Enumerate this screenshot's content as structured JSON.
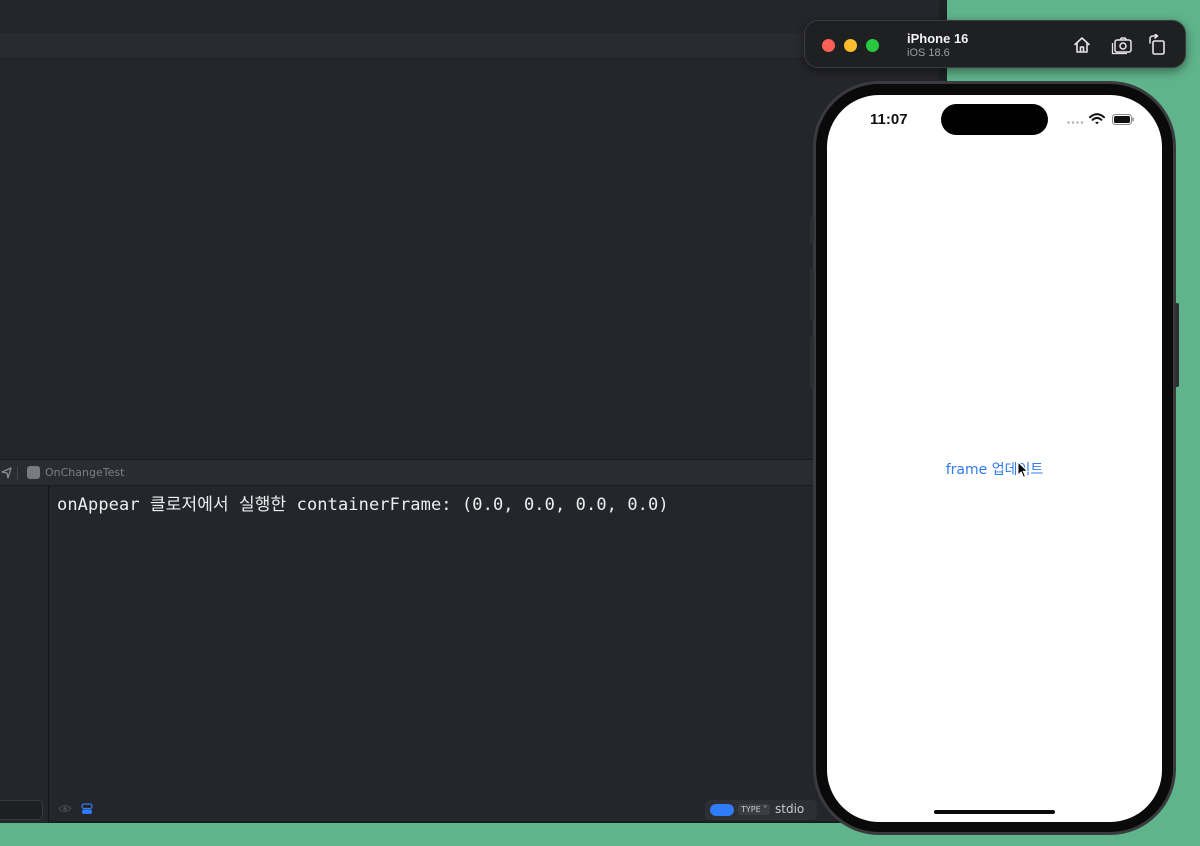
{
  "xcode": {
    "scheme_name": "OnChangeTest",
    "console_output": "onAppear 클로저에서 실행한 containerFrame: (0.0, 0.0, 0.0, 0.0)",
    "type_label": "TYPE",
    "stream_label": "stdio"
  },
  "simulator": {
    "device_name": "iPhone 16",
    "os_version": "iOS 18.6",
    "buttons": [
      "home-icon",
      "screenshot-icon",
      "rotate-icon"
    ]
  },
  "phone": {
    "time": "11:07",
    "button_label": "frame 업데이트"
  },
  "colors": {
    "background": "#5fb48b",
    "xcode_bg": "#25262b",
    "accent_blue": "#2f7cf6",
    "link_blue": "#2f7ce8"
  }
}
